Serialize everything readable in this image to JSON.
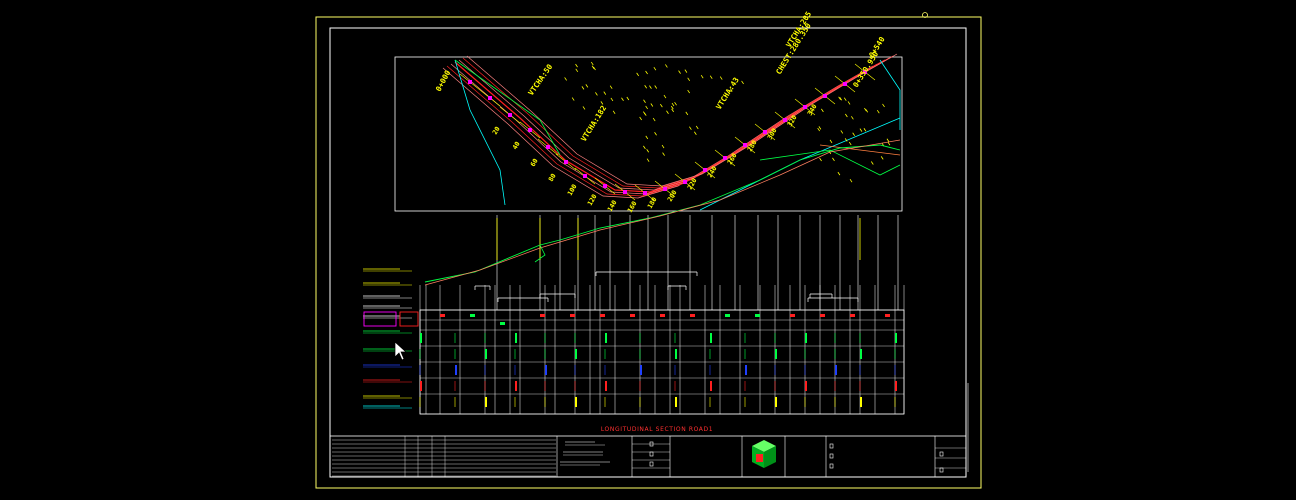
{
  "drawing": {
    "title": "LONGITUDINAL SECTION ROAD1",
    "plan_labels": [
      "0+000",
      "VTCHA:50",
      "VTCHA:182",
      "VTCHA:43",
      "CHEST:280.350",
      "VTCHA:205",
      "0+350.950",
      "0+540"
    ],
    "station_marks": [
      "20",
      "40",
      "60",
      "80",
      "100",
      "120",
      "140",
      "160",
      "180",
      "200",
      "220",
      "240",
      "260",
      "280",
      "300",
      "320",
      "340"
    ]
  },
  "colors": {
    "frame": "#ffff66",
    "border": "#ffffff",
    "alignment": "#ff2020",
    "offset": "#ff8080",
    "text": "#ffff00",
    "cyan": "#00ffff",
    "green": "#00ff44",
    "magenta": "#ff00ff",
    "blue": "#2040ff",
    "title": "#ff3030"
  },
  "icons": [
    "cursor-arrow-icon",
    "green-cube-logo-icon"
  ]
}
